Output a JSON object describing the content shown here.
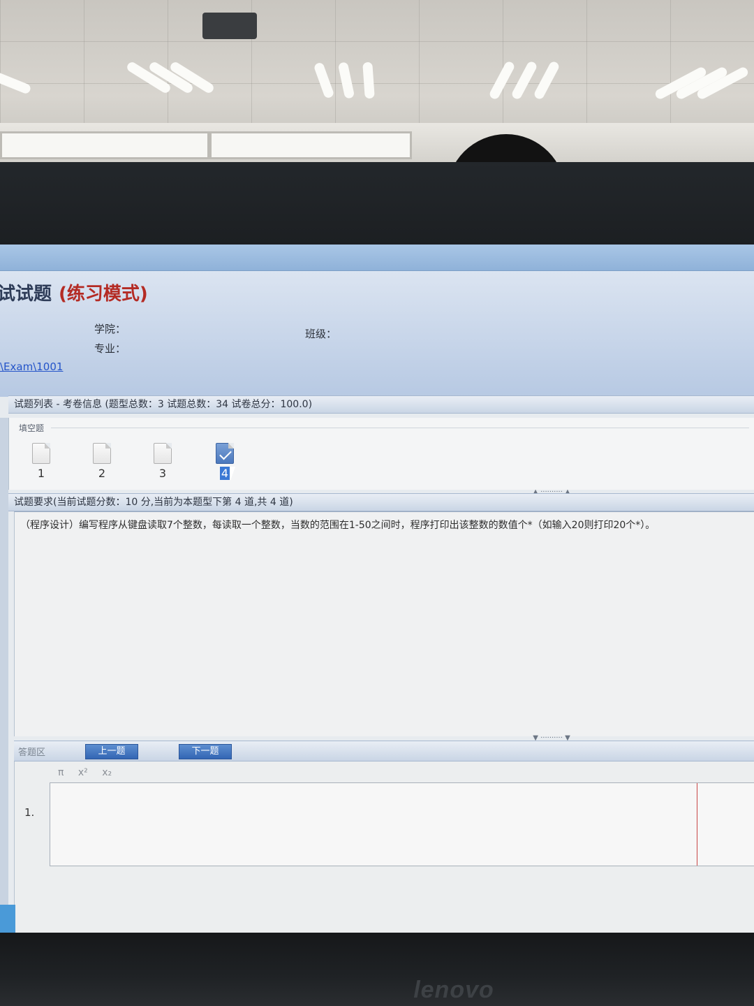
{
  "exam": {
    "title": "试试题",
    "mode": "(练习模式)",
    "college_label": "学院：",
    "major_label": "专业：",
    "class_label": "班级：",
    "path_link": "\\Exam\\1001"
  },
  "question_list": {
    "header": "试题列表 - 考卷信息 (题型总数：3  试题总数：34  试卷总分：100.0)",
    "type_label": "填空题",
    "items": [
      {
        "number": "1",
        "state": "unanswered"
      },
      {
        "number": "2",
        "state": "unanswered"
      },
      {
        "number": "3",
        "state": "unanswered"
      },
      {
        "number": "4",
        "state": "current"
      }
    ]
  },
  "question": {
    "header": "试题要求(当前试题分数：10 分,当前为本题型下第 4 道,共 4 道)",
    "text": "（程序设计）编写程序从键盘读取7个整数，每读取一个整数，当数的范围在1-50之间时，程序打印出该整数的数值个*（如输入20则打印20个*）。"
  },
  "answer": {
    "label": "答题区",
    "prev_button": "上一题",
    "next_button": "下一题",
    "toolbar": [
      "π",
      "x²",
      "x₂"
    ],
    "blank_number": "1."
  },
  "monitor": {
    "brand": "lenovo"
  },
  "colors": {
    "accent_blue": "#3366b4",
    "title_red": "#b42b24",
    "link_blue": "#2454c9"
  }
}
